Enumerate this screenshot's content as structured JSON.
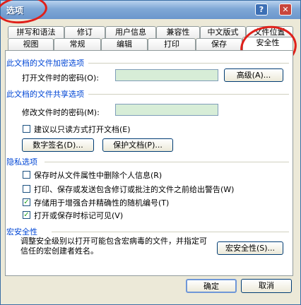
{
  "window": {
    "title": "选项",
    "help_label": "?",
    "close_label": "✕"
  },
  "tabs_row1": [
    "拼写和语法",
    "修订",
    "用户信息",
    "兼容性",
    "中文版式",
    "文件位置"
  ],
  "tabs_row2": [
    "视图",
    "常规",
    "编辑",
    "打印",
    "保存",
    "安全性"
  ],
  "active_tab": "安全性",
  "encryption": {
    "section_title": "此文档的文件加密选项",
    "open_password_label": "打开文件时的密码(O):",
    "open_password_value": "",
    "advanced_button": "高级(A)..."
  },
  "sharing": {
    "section_title": "此文档的文件共享选项",
    "modify_password_label": "修改文件时的密码(M):",
    "modify_password_value": "",
    "readonly_checkbox": {
      "label": "建议以只读方式打开文档(E)",
      "checked": false
    },
    "digital_signature_button": "数字签名(D)...",
    "protect_document_button": "保护文档(P)..."
  },
  "privacy": {
    "section_title": "隐私选项",
    "options": [
      {
        "label": "保存时从文件属性中删除个人信息(R)",
        "checked": false
      },
      {
        "label": "打印、保存或发送包含修订或批注的文件之前给出警告(W)",
        "checked": false
      },
      {
        "label": "存储用于增强合并精确性的随机编号(T)",
        "checked": true
      },
      {
        "label": "打开或保存时标记可见(V)",
        "checked": true
      }
    ]
  },
  "macro": {
    "section_title": "宏安全性",
    "description": "调整安全级别以打开可能包含宏病毒的文件，并指定可信任的宏创建者姓名。",
    "macro_security_button": "宏安全性(S)..."
  },
  "footer": {
    "ok": "确定",
    "cancel": "取消"
  }
}
